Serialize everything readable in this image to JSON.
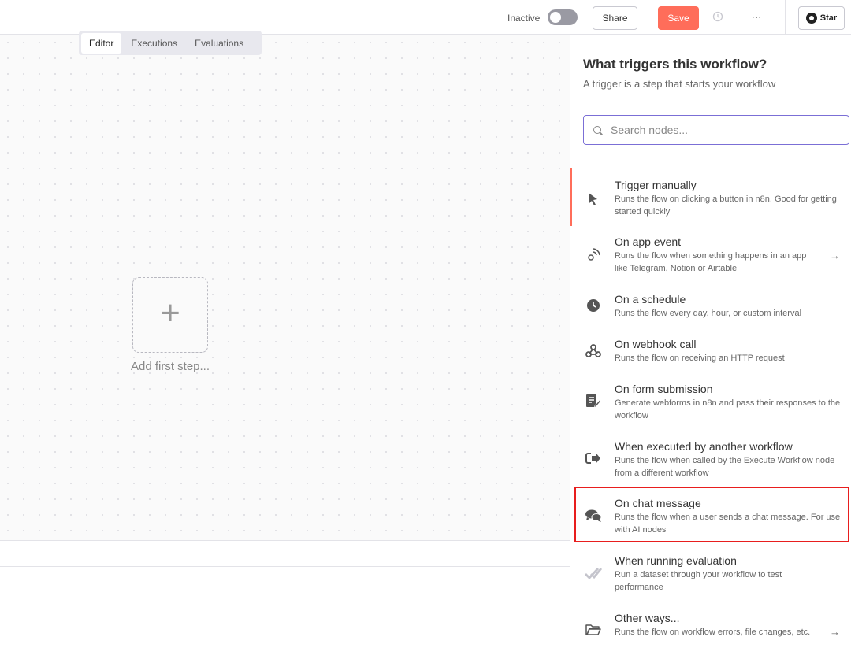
{
  "topbar": {
    "status": "Inactive",
    "share": "Share",
    "save": "Save",
    "more": "···",
    "star": "Star"
  },
  "tabs": [
    {
      "label": "Editor",
      "active": true
    },
    {
      "label": "Executions",
      "active": false
    },
    {
      "label": "Evaluations",
      "active": false
    }
  ],
  "canvas": {
    "add_plus": "+",
    "add_label": "Add first step..."
  },
  "panel": {
    "title": "What triggers this workflow?",
    "subtitle": "A trigger is a step that starts your workflow",
    "search_placeholder": "Search nodes...",
    "nodes": [
      {
        "name": "Trigger manually",
        "desc": "Runs the flow on clicking a button in n8n. Good for getting started quickly",
        "icon": "cursor-icon"
      },
      {
        "name": "On app event",
        "desc": "Runs the flow when something happens in an app like Telegram, Notion or Airtable",
        "icon": "satellite-icon",
        "arrow": "→"
      },
      {
        "name": "On a schedule",
        "desc": "Runs the flow every day, hour, or custom interval",
        "icon": "clock-icon"
      },
      {
        "name": "On webhook call",
        "desc": "Runs the flow on receiving an HTTP request",
        "icon": "webhook-icon"
      },
      {
        "name": "On form submission",
        "desc": "Generate webforms in n8n and pass their responses to the workflow",
        "icon": "form-icon"
      },
      {
        "name": "When executed by another workflow",
        "desc": "Runs the flow when called by the Execute Workflow node from a different workflow",
        "icon": "sign-in-icon"
      },
      {
        "name": "On chat message",
        "desc": "Runs the flow when a user sends a chat message. For use with AI nodes",
        "icon": "chat-icon"
      },
      {
        "name": "When running evaluation",
        "desc": "Run a dataset through your workflow to test performance",
        "icon": "check-double-icon"
      },
      {
        "name": "Other ways...",
        "desc": "Runs the flow on workflow errors, file changes, etc.",
        "icon": "folder-icon",
        "arrow": "→"
      }
    ]
  },
  "colors": {
    "save": "#ff6d5a",
    "accent": "#7b6fd6",
    "highlight": "#e81e1e"
  }
}
